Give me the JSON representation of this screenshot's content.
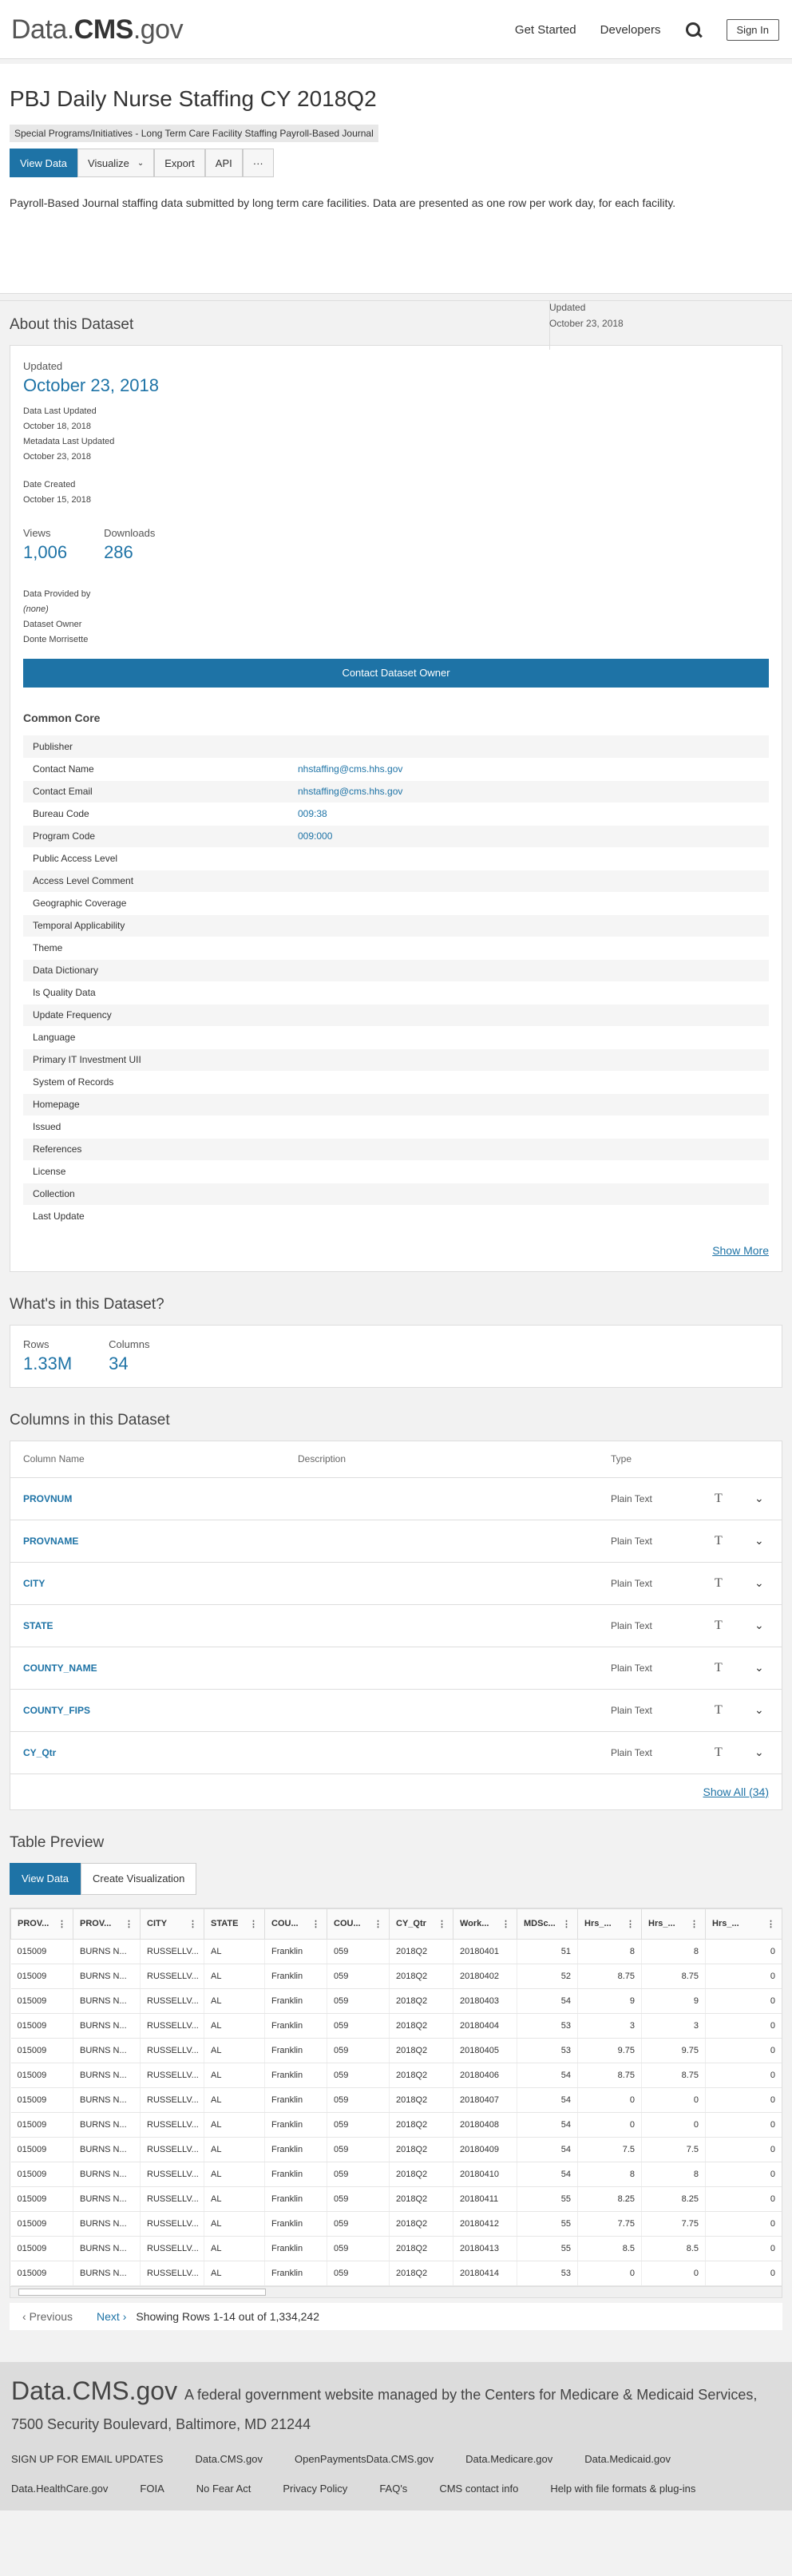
{
  "header": {
    "logo_pre": "Data.",
    "logo_bold": "CMS",
    "logo_post": ".gov",
    "get_started": "Get Started",
    "developers": "Developers",
    "sign_in": "Sign In"
  },
  "dataset": {
    "title": "PBJ Daily Nurse Staffing CY 2018Q2",
    "category": "Special Programs/Initiatives - Long Term Care Facility Staffing Payroll-Based Journal",
    "buttons": {
      "view_data": "View Data",
      "visualize": "Visualize",
      "export": "Export",
      "api": "API",
      "more": "···"
    },
    "description": "Payroll-Based Journal staffing data submitted by long term care facilities. Data are presented as one row per work day, for each facility.",
    "updated_label": "Updated",
    "updated_value": "October 23, 2018"
  },
  "about": {
    "heading": "About this Dataset",
    "updated_label": "Updated",
    "updated_value": "October 23, 2018",
    "data_last_updated_label": "Data Last Updated",
    "data_last_updated": "October 18, 2018",
    "metadata_last_updated_label": "Metadata Last Updated",
    "metadata_last_updated": "October 23, 2018",
    "date_created_label": "Date Created",
    "date_created": "October 15, 2018",
    "views_label": "Views",
    "views": "1,006",
    "downloads_label": "Downloads",
    "downloads": "286",
    "provided_by_label": "Data Provided by",
    "provided_by": "(none)",
    "owner_label": "Dataset Owner",
    "owner": "Donte Morrisette",
    "contact_button": "Contact Dataset Owner",
    "common_core": "Common Core",
    "show_more": "Show More",
    "meta": [
      [
        "Publisher",
        ""
      ],
      [
        "Contact Name",
        "nhstaffing@cms.hhs.gov"
      ],
      [
        "Contact Email",
        "nhstaffing@cms.hhs.gov"
      ],
      [
        "Bureau Code",
        "009:38"
      ],
      [
        "Program Code",
        "009:000"
      ],
      [
        "Public Access Level",
        ""
      ],
      [
        "Access Level Comment",
        ""
      ],
      [
        "Geographic Coverage",
        ""
      ],
      [
        "Temporal Applicability",
        ""
      ],
      [
        "Theme",
        ""
      ],
      [
        "Data Dictionary",
        ""
      ],
      [
        "Is Quality Data",
        ""
      ],
      [
        "Update Frequency",
        ""
      ],
      [
        "Language",
        ""
      ],
      [
        "Primary IT Investment UII",
        ""
      ],
      [
        "System of Records",
        ""
      ],
      [
        "Homepage",
        ""
      ],
      [
        "Issued",
        ""
      ],
      [
        "References",
        ""
      ],
      [
        "License",
        ""
      ],
      [
        "Collection",
        ""
      ],
      [
        "Last Update",
        ""
      ]
    ]
  },
  "whats": {
    "heading": "What's in this Dataset?",
    "rows_label": "Rows",
    "rows": "1.33M",
    "columns_label": "Columns",
    "columns": "34"
  },
  "columns": {
    "heading": "Columns in this Dataset",
    "h_name": "Column Name",
    "h_desc": "Description",
    "h_type": "Type",
    "items": [
      {
        "name": "PROVNUM",
        "type": "Plain Text"
      },
      {
        "name": "PROVNAME",
        "type": "Plain Text"
      },
      {
        "name": "CITY",
        "type": "Plain Text"
      },
      {
        "name": "STATE",
        "type": "Plain Text"
      },
      {
        "name": "COUNTY_NAME",
        "type": "Plain Text"
      },
      {
        "name": "COUNTY_FIPS",
        "type": "Plain Text"
      },
      {
        "name": "CY_Qtr",
        "type": "Plain Text"
      }
    ],
    "type_glyph": "T",
    "show_all": "Show All (34)"
  },
  "preview": {
    "heading": "Table Preview",
    "view_data": "View Data",
    "create_vis": "Create Visualization",
    "headers": [
      "PROV...",
      "PROV...",
      "CITY",
      "STATE",
      "COU...",
      "COU...",
      "CY_Qtr",
      "Work...",
      "MDSc...",
      "Hrs_...",
      "Hrs_...",
      "Hrs_..."
    ],
    "rows": [
      [
        "015009",
        "BURNS N...",
        "RUSSELLV...",
        "AL",
        "Franklin",
        "059",
        "2018Q2",
        "20180401",
        "51",
        "8",
        "8",
        "0"
      ],
      [
        "015009",
        "BURNS N...",
        "RUSSELLV...",
        "AL",
        "Franklin",
        "059",
        "2018Q2",
        "20180402",
        "52",
        "8.75",
        "8.75",
        "0"
      ],
      [
        "015009",
        "BURNS N...",
        "RUSSELLV...",
        "AL",
        "Franklin",
        "059",
        "2018Q2",
        "20180403",
        "54",
        "9",
        "9",
        "0"
      ],
      [
        "015009",
        "BURNS N...",
        "RUSSELLV...",
        "AL",
        "Franklin",
        "059",
        "2018Q2",
        "20180404",
        "53",
        "3",
        "3",
        "0"
      ],
      [
        "015009",
        "BURNS N...",
        "RUSSELLV...",
        "AL",
        "Franklin",
        "059",
        "2018Q2",
        "20180405",
        "53",
        "9.75",
        "9.75",
        "0"
      ],
      [
        "015009",
        "BURNS N...",
        "RUSSELLV...",
        "AL",
        "Franklin",
        "059",
        "2018Q2",
        "20180406",
        "54",
        "8.75",
        "8.75",
        "0"
      ],
      [
        "015009",
        "BURNS N...",
        "RUSSELLV...",
        "AL",
        "Franklin",
        "059",
        "2018Q2",
        "20180407",
        "54",
        "0",
        "0",
        "0"
      ],
      [
        "015009",
        "BURNS N...",
        "RUSSELLV...",
        "AL",
        "Franklin",
        "059",
        "2018Q2",
        "20180408",
        "54",
        "0",
        "0",
        "0"
      ],
      [
        "015009",
        "BURNS N...",
        "RUSSELLV...",
        "AL",
        "Franklin",
        "059",
        "2018Q2",
        "20180409",
        "54",
        "7.5",
        "7.5",
        "0"
      ],
      [
        "015009",
        "BURNS N...",
        "RUSSELLV...",
        "AL",
        "Franklin",
        "059",
        "2018Q2",
        "20180410",
        "54",
        "8",
        "8",
        "0"
      ],
      [
        "015009",
        "BURNS N...",
        "RUSSELLV...",
        "AL",
        "Franklin",
        "059",
        "2018Q2",
        "20180411",
        "55",
        "8.25",
        "8.25",
        "0"
      ],
      [
        "015009",
        "BURNS N...",
        "RUSSELLV...",
        "AL",
        "Franklin",
        "059",
        "2018Q2",
        "20180412",
        "55",
        "7.75",
        "7.75",
        "0"
      ],
      [
        "015009",
        "BURNS N...",
        "RUSSELLV...",
        "AL",
        "Franklin",
        "059",
        "2018Q2",
        "20180413",
        "55",
        "8.5",
        "8.5",
        "0"
      ],
      [
        "015009",
        "BURNS N...",
        "RUSSELLV...",
        "AL",
        "Franklin",
        "059",
        "2018Q2",
        "20180414",
        "53",
        "0",
        "0",
        "0"
      ]
    ],
    "previous": "Previous",
    "next": "Next",
    "showing": "Showing Rows 1-14 out of 1,334,242"
  },
  "footer": {
    "logo": "Data.CMS.gov",
    "tagline": "A federal government website managed by the Centers for Medicare & Medicaid Services, 7500 Security Boulevard, Baltimore, MD 21244",
    "links": [
      "SIGN UP FOR EMAIL UPDATES",
      "Data.CMS.gov",
      "OpenPaymentsData.CMS.gov",
      "Data.Medicare.gov",
      "Data.Medicaid.gov",
      "Data.HealthCare.gov",
      "FOIA",
      "No Fear Act",
      "Privacy Policy",
      "FAQ's",
      "CMS contact info",
      "Help with file formats & plug-ins"
    ]
  }
}
